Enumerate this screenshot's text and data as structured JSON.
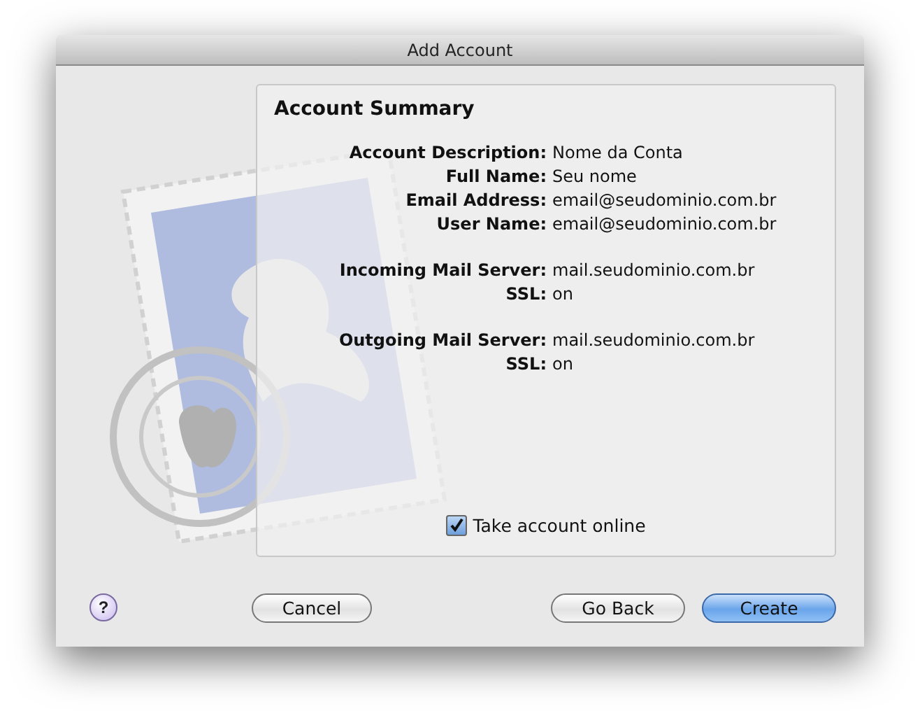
{
  "window": {
    "title": "Add Account"
  },
  "summary": {
    "heading": "Account Summary",
    "groups": [
      {
        "rows": [
          {
            "label": "Account Description:",
            "value": "Nome da Conta"
          },
          {
            "label": "Full Name:",
            "value": "Seu nome"
          },
          {
            "label": "Email Address:",
            "value": "email@seudominio.com.br"
          },
          {
            "label": "User Name:",
            "value": "email@seudominio.com.br"
          }
        ]
      },
      {
        "rows": [
          {
            "label": "Incoming Mail Server:",
            "value": "mail.seudominio.com.br"
          },
          {
            "label": "SSL:",
            "value": "on"
          }
        ]
      },
      {
        "rows": [
          {
            "label": "Outgoing Mail Server:",
            "value": "mail.seudominio.com.br"
          },
          {
            "label": "SSL:",
            "value": "on"
          }
        ]
      }
    ],
    "checkbox": {
      "label": "Take account online",
      "checked": true
    }
  },
  "help": {
    "label": "?"
  },
  "buttons": [
    {
      "label": "Cancel",
      "kind": "plain"
    },
    {
      "label": "Go Back",
      "kind": "plain"
    },
    {
      "label": "Create",
      "kind": "default"
    }
  ]
}
